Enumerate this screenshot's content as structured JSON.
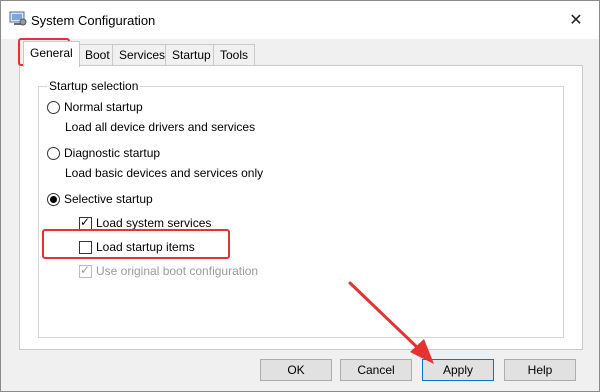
{
  "window": {
    "title": "System Configuration"
  },
  "tabs": [
    {
      "label": "General"
    },
    {
      "label": "Boot"
    },
    {
      "label": "Services"
    },
    {
      "label": "Startup"
    },
    {
      "label": "Tools"
    }
  ],
  "startup_selection": {
    "label": "Startup selection",
    "normal": {
      "label": "Normal startup",
      "description": "Load all device drivers and services",
      "selected": false
    },
    "diagnostic": {
      "label": "Diagnostic startup",
      "description": "Load basic devices and services only",
      "selected": false
    },
    "selective": {
      "label": "Selective startup",
      "selected": true
    },
    "options": [
      {
        "label": "Load system services",
        "checked": true,
        "enabled": true
      },
      {
        "label": "Load startup items",
        "checked": false,
        "enabled": true
      },
      {
        "label": "Use original boot configuration",
        "checked": true,
        "enabled": false
      }
    ]
  },
  "buttons": {
    "ok": "OK",
    "cancel": "Cancel",
    "apply": "Apply",
    "help": "Help"
  },
  "colors": {
    "highlight": "#e53333",
    "accent": "#0078d7"
  },
  "icons": {
    "app": "msconfig-icon",
    "close": "close-icon"
  }
}
